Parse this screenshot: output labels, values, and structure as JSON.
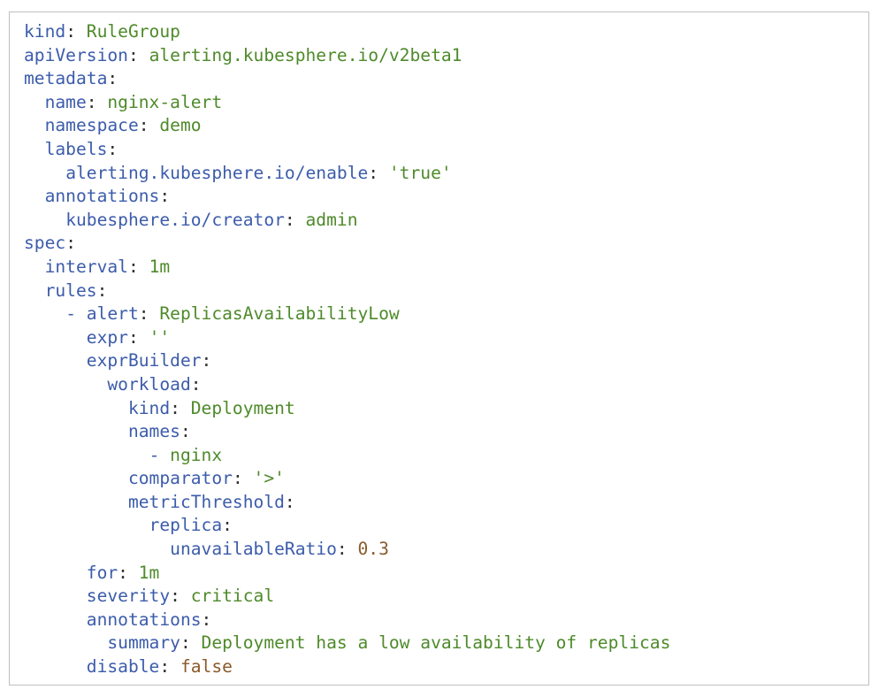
{
  "code_block": {
    "language": "yaml",
    "lines": [
      {
        "indent": "",
        "dash": "",
        "key": "kind",
        "value": "RuleGroup",
        "value_type": "string"
      },
      {
        "indent": "",
        "dash": "",
        "key": "apiVersion",
        "value": "alerting.kubesphere.io/v2beta1",
        "value_type": "string"
      },
      {
        "indent": "",
        "dash": "",
        "key": "metadata",
        "value": "",
        "value_type": "none"
      },
      {
        "indent": "  ",
        "dash": "",
        "key": "name",
        "value": "nginx-alert",
        "value_type": "string"
      },
      {
        "indent": "  ",
        "dash": "",
        "key": "namespace",
        "value": "demo",
        "value_type": "string"
      },
      {
        "indent": "  ",
        "dash": "",
        "key": "labels",
        "value": "",
        "value_type": "none"
      },
      {
        "indent": "    ",
        "dash": "",
        "key": "alerting.kubesphere.io/enable",
        "value": "'true'",
        "value_type": "string"
      },
      {
        "indent": "  ",
        "dash": "",
        "key": "annotations",
        "value": "",
        "value_type": "none"
      },
      {
        "indent": "    ",
        "dash": "",
        "key": "kubesphere.io/creator",
        "value": "admin",
        "value_type": "string"
      },
      {
        "indent": "",
        "dash": "",
        "key": "spec",
        "value": "",
        "value_type": "none"
      },
      {
        "indent": "  ",
        "dash": "",
        "key": "interval",
        "value": "1m",
        "value_type": "string"
      },
      {
        "indent": "  ",
        "dash": "",
        "key": "rules",
        "value": "",
        "value_type": "none"
      },
      {
        "indent": "    ",
        "dash": "- ",
        "key": "alert",
        "value": "ReplicasAvailabilityLow",
        "value_type": "string"
      },
      {
        "indent": "      ",
        "dash": "",
        "key": "expr",
        "value": "''",
        "value_type": "string"
      },
      {
        "indent": "      ",
        "dash": "",
        "key": "exprBuilder",
        "value": "",
        "value_type": "none"
      },
      {
        "indent": "        ",
        "dash": "",
        "key": "workload",
        "value": "",
        "value_type": "none"
      },
      {
        "indent": "          ",
        "dash": "",
        "key": "kind",
        "value": "Deployment",
        "value_type": "string"
      },
      {
        "indent": "          ",
        "dash": "",
        "key": "names",
        "value": "",
        "value_type": "none"
      },
      {
        "indent": "            ",
        "dash": "- ",
        "key": "",
        "value": "nginx",
        "value_type": "string"
      },
      {
        "indent": "          ",
        "dash": "",
        "key": "comparator",
        "value": "'>'",
        "value_type": "string"
      },
      {
        "indent": "          ",
        "dash": "",
        "key": "metricThreshold",
        "value": "",
        "value_type": "none"
      },
      {
        "indent": "            ",
        "dash": "",
        "key": "replica",
        "value": "",
        "value_type": "none"
      },
      {
        "indent": "              ",
        "dash": "",
        "key": "unavailableRatio",
        "value": "0.3",
        "value_type": "number"
      },
      {
        "indent": "      ",
        "dash": "",
        "key": "for",
        "value": "1m",
        "value_type": "string"
      },
      {
        "indent": "      ",
        "dash": "",
        "key": "severity",
        "value": "critical",
        "value_type": "string"
      },
      {
        "indent": "      ",
        "dash": "",
        "key": "annotations",
        "value": "",
        "value_type": "none"
      },
      {
        "indent": "        ",
        "dash": "",
        "key": "summary",
        "value": "Deployment has a low availability of replicas",
        "value_type": "string"
      },
      {
        "indent": "      ",
        "dash": "",
        "key": "disable",
        "value": "false",
        "value_type": "boolean"
      }
    ]
  },
  "colors": {
    "key": "#3c5cab",
    "string_value": "#4e8a2a",
    "literal_value": "#8a5a2a",
    "punctuation": "#2e2e2e",
    "border": "#bfbfbf",
    "background": "#ffffff"
  }
}
